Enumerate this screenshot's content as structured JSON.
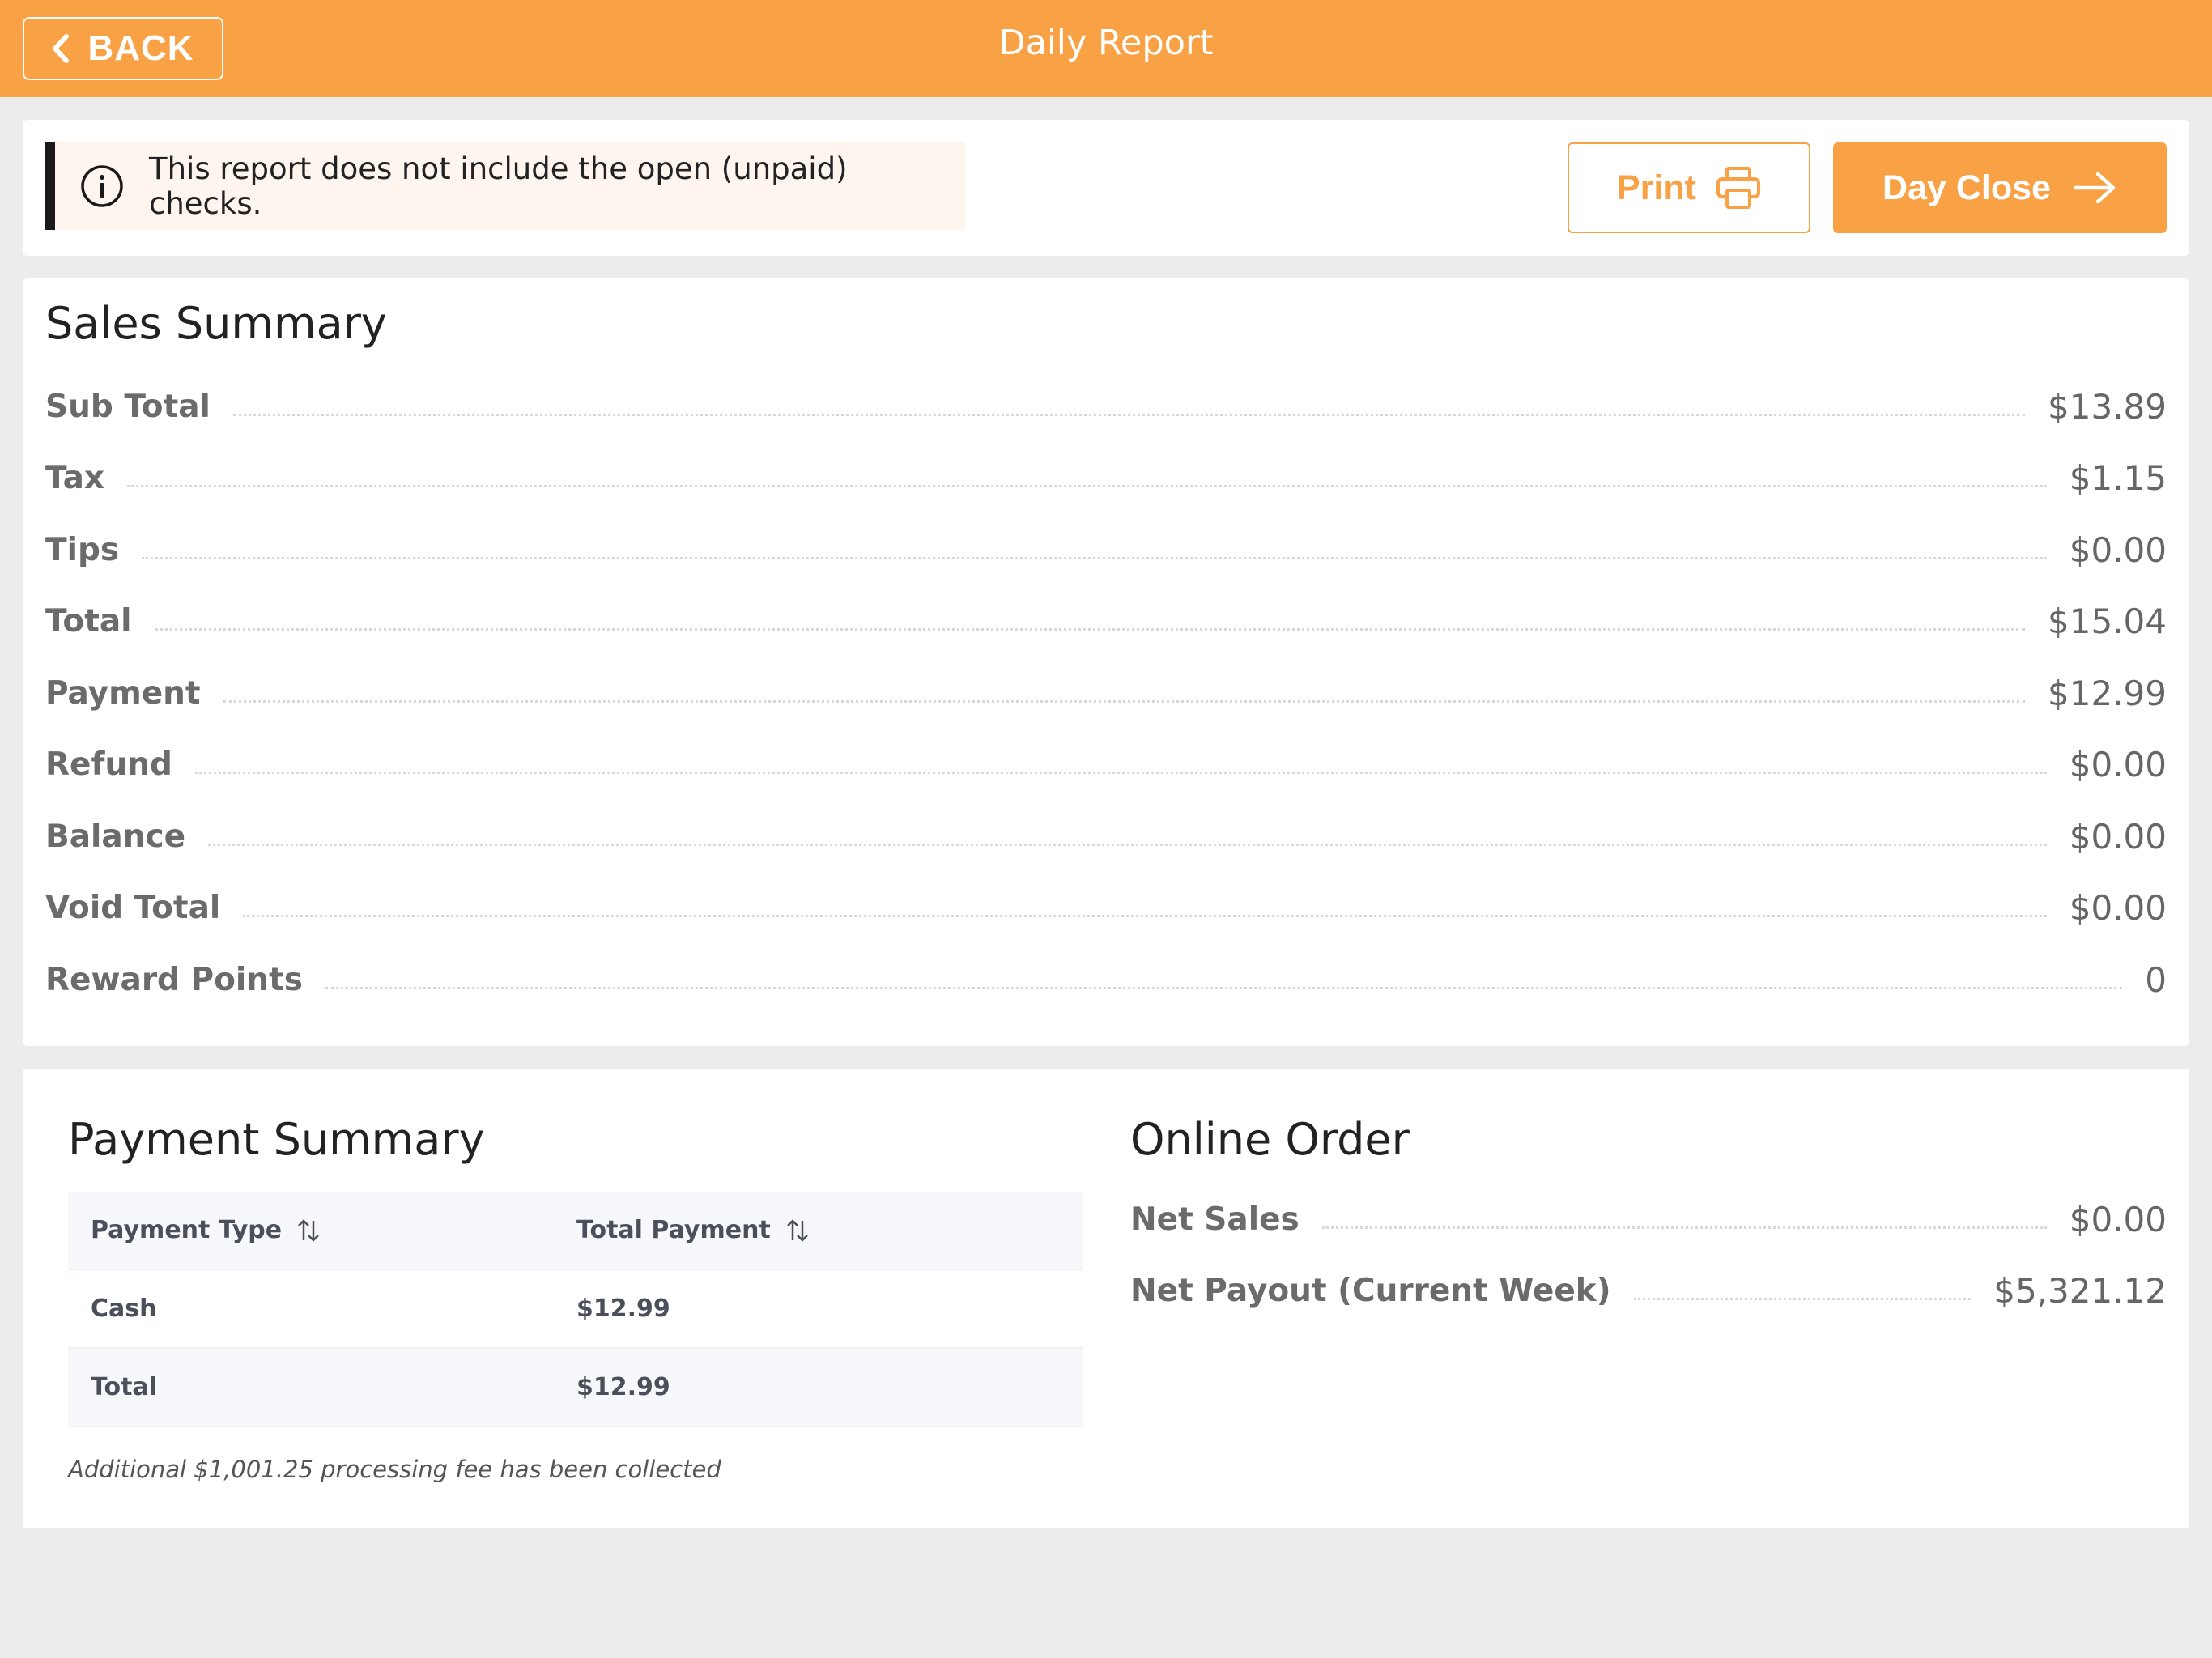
{
  "header": {
    "back_label": "BACK",
    "title": "Daily Report"
  },
  "notice": {
    "icon": "info-icon",
    "text": "This report does not include the open (unpaid) checks."
  },
  "actions": {
    "print_label": "Print",
    "print_icon": "printer-icon",
    "day_close_label": "Day Close",
    "day_close_icon": "arrow-right-icon"
  },
  "sales_summary": {
    "title": "Sales Summary",
    "rows": [
      {
        "label": "Sub Total",
        "value": "$13.89"
      },
      {
        "label": "Tax",
        "value": "$1.15"
      },
      {
        "label": "Tips",
        "value": "$0.00"
      },
      {
        "label": "Total",
        "value": "$15.04"
      },
      {
        "label": "Payment",
        "value": "$12.99"
      },
      {
        "label": "Refund",
        "value": "$0.00"
      },
      {
        "label": "Balance",
        "value": "$0.00"
      },
      {
        "label": "Void Total",
        "value": "$0.00"
      },
      {
        "label": "Reward Points",
        "value": "0"
      }
    ]
  },
  "payment_summary": {
    "title": "Payment Summary",
    "columns": [
      "Payment Type",
      "Total Payment"
    ],
    "rows": [
      [
        "Cash",
        "$12.99"
      ],
      [
        "Total",
        "$12.99"
      ]
    ],
    "note": "Additional $1,001.25 processing fee has been collected"
  },
  "online_order": {
    "title": "Online Order",
    "rows": [
      {
        "label": "Net Sales",
        "value": "$0.00"
      },
      {
        "label": "Net Payout (Current Week)",
        "value": "$5,321.12"
      }
    ]
  },
  "colors": {
    "accent": "#f9a145",
    "background": "#ececec"
  }
}
